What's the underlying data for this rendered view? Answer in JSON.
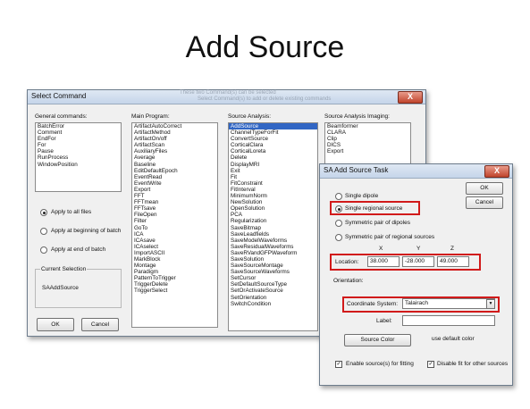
{
  "slide": {
    "title": "Add Source"
  },
  "select_command": {
    "window_title": "Select Command",
    "close_label": "X",
    "background_hint_1": "These two Command(s) can be selected",
    "background_hint_2": "Select Command(s) to add or delete existing commands",
    "general": {
      "header": "General commands:",
      "items": [
        "BatchError",
        "Comment",
        "EndFor",
        "For",
        "Pause",
        "RunProcess",
        "WindowPosition"
      ]
    },
    "main": {
      "header": "Main Program:",
      "items": [
        "ArtifactAutoCorrect",
        "ArtifactMethod",
        "ArtifactOn/off",
        "ArtifactScan",
        "AuxiliaryFiles",
        "Average",
        "Baseline",
        "EditDefaultEpoch",
        "EventRead",
        "EventWrite",
        "Export",
        "FFT",
        "FFTmean",
        "FFTsave",
        "FileOpen",
        "Filter",
        "GoTo",
        "ICA",
        "ICAsave",
        "ICAselect",
        "ImportASCII",
        "MarkBlock",
        "Montage",
        "Paradigm",
        "PatternToTrigger",
        "TriggerDelete",
        "TriggerSelect"
      ]
    },
    "analysis": {
      "header": "Source Analysis:",
      "items": [
        "AddSource",
        "ChannelTypeForFit",
        "ConvertSource",
        "CorticalClara",
        "CorticalLoreta",
        "Delete",
        "DisplayMRI",
        "Exit",
        "Fit",
        "FitConstraint",
        "FitInterval",
        "MinimumNorm",
        "NewSolution",
        "OpenSolution",
        "PCA",
        "Regularization",
        "SaveBitmap",
        "SaveLeadfields",
        "SaveModelWaveforms",
        "SaveResidualWaveforms",
        "SaveRVandGFPWaveform",
        "SaveSolution",
        "SaveSourceMontage",
        "SaveSourceWaveforms",
        "SetCursor",
        "SetDefaultSourceType",
        "SetOrActivateSource",
        "SetOrientation",
        "SwitchCondition"
      ],
      "selected_index": 0
    },
    "imaging": {
      "header": "Source Analysis Imaging:",
      "items": [
        "Beamformer",
        "CLARA",
        "Clip",
        "DICS",
        "Export"
      ]
    },
    "apply_options": [
      "Apply to all files",
      "Apply at beginning of batch",
      "Apply at end of batch"
    ],
    "apply_selected": 0,
    "current_selection_label": "Current Selection",
    "current_selection_value": "SAAddSource",
    "ok_label": "OK",
    "cancel_label": "Cancel"
  },
  "add_source": {
    "window_title": "SA Add Source Task",
    "close_label": "X",
    "ok_label": "OK",
    "cancel_label": "Cancel",
    "source_types": [
      "Single dipole",
      "Single regional source",
      "Symmetric pair of dipoles",
      "Symmetric pair of regional sources"
    ],
    "source_type_selected": 1,
    "axis_x": "X",
    "axis_y": "Y",
    "axis_z": "Z",
    "location_label": "Location:",
    "location_x": "38.000",
    "location_y": "-28.000",
    "location_z": "49.000",
    "orientation_label": "Orientation:",
    "coordinate_label": "Coordinate System:",
    "coordinate_value": "Talairach",
    "label_label": "Label:",
    "label_value": "",
    "source_color_label": "Source Color",
    "default_color_label": "use default color",
    "enable_fitting_label": "Enable source(s) for fitting",
    "disable_fit_label": "Disable fit for other sources",
    "enable_fitting_checked": true,
    "disable_fit_checked": true
  },
  "colors": {
    "highlight": "#d11a1a",
    "selection": "#3166c4"
  }
}
